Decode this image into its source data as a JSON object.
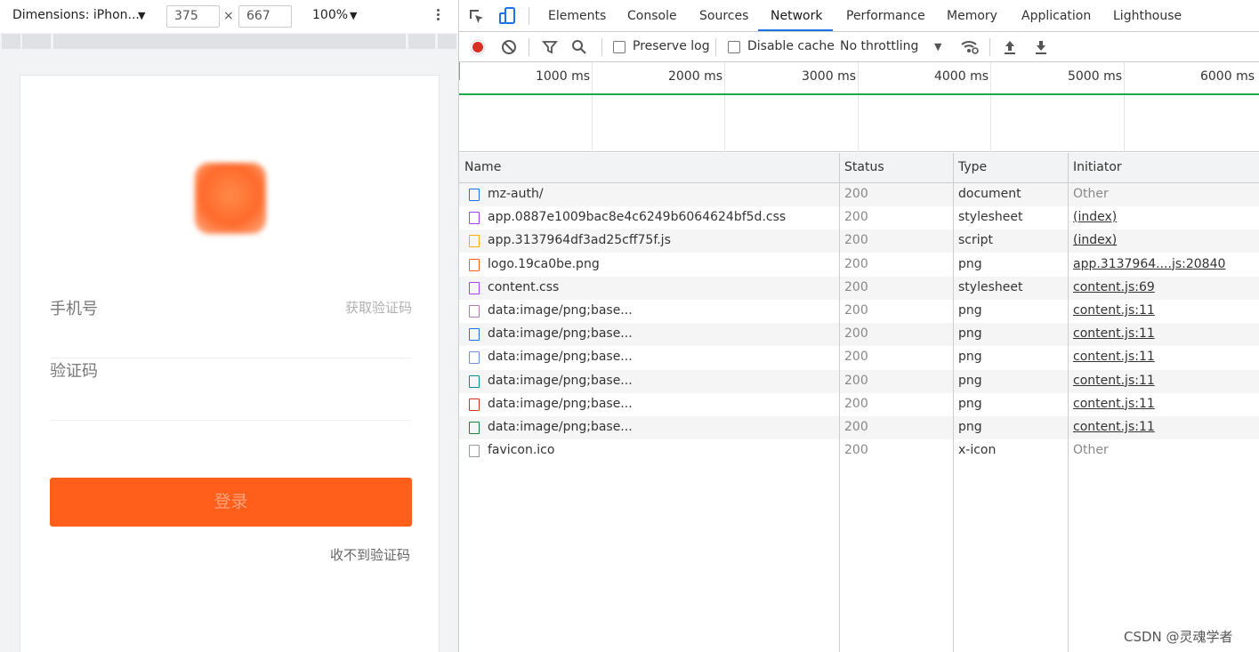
{
  "device_toolbar": {
    "dimensions_label": "Dimensions: iPhon...",
    "width": "375",
    "height": "667",
    "separator": "×",
    "zoom": "100%"
  },
  "phone_page": {
    "phone_label": "手机号",
    "get_code_label": "获取验证码",
    "code_label": "验证码",
    "login_button": "登录",
    "no_code_link": "收不到验证码",
    "accent_color": "#ff5f1a"
  },
  "devtools": {
    "tabs": [
      "Elements",
      "Console",
      "Sources",
      "Network",
      "Performance",
      "Memory",
      "Application",
      "Lighthouse"
    ],
    "active_tab": "Network",
    "toolbar": {
      "preserve_log": "Preserve log",
      "disable_cache": "Disable cache",
      "throttling": "No throttling"
    },
    "timeline_labels": [
      "1000 ms",
      "2000 ms",
      "3000 ms",
      "4000 ms",
      "5000 ms",
      "6000 ms"
    ],
    "columns": [
      "Name",
      "Status",
      "Type",
      "Initiator"
    ],
    "requests": [
      {
        "name": "mz-auth/",
        "status": "200",
        "type": "document",
        "initiator": "Other",
        "icon": "document-icon",
        "icon_color": "#1a73e8"
      },
      {
        "name": "app.0887e1009bac8e4c6249b6064624bf5d.css",
        "status": "200",
        "type": "stylesheet",
        "initiator": "(index)",
        "icon": "stylesheet-icon",
        "icon_color": "#a142f4"
      },
      {
        "name": "app.3137964df3ad25cff75f.js",
        "status": "200",
        "type": "script",
        "initiator": "(index)",
        "icon": "script-icon",
        "icon_color": "#f9ab00"
      },
      {
        "name": "logo.19ca0be.png",
        "status": "200",
        "type": "png",
        "initiator": "app.3137964....js:20840",
        "icon": "image-icon",
        "icon_color": "#ff5f1a"
      },
      {
        "name": "content.css",
        "status": "200",
        "type": "stylesheet",
        "initiator": "content.js:69",
        "icon": "stylesheet-icon",
        "icon_color": "#a142f4"
      },
      {
        "name": "data:image/png;base...",
        "status": "200",
        "type": "png",
        "initiator": "content.js:11",
        "icon": "image-icon",
        "icon_color": "#b07ab0"
      },
      {
        "name": "data:image/png;base...",
        "status": "200",
        "type": "png",
        "initiator": "content.js:11",
        "icon": "image-icon",
        "icon_color": "#1a73e8"
      },
      {
        "name": "data:image/png;base...",
        "status": "200",
        "type": "png",
        "initiator": "content.js:11",
        "icon": "image-icon",
        "icon_color": "#6f8fd8"
      },
      {
        "name": "data:image/png;base...",
        "status": "200",
        "type": "png",
        "initiator": "content.js:11",
        "icon": "image-icon",
        "icon_color": "#0b8a8a"
      },
      {
        "name": "data:image/png;base...",
        "status": "200",
        "type": "png",
        "initiator": "content.js:11",
        "icon": "image-icon",
        "icon_color": "#d93025"
      },
      {
        "name": "data:image/png;base...",
        "status": "200",
        "type": "png",
        "initiator": "content.js:11",
        "icon": "image-icon",
        "icon_color": "#188038"
      },
      {
        "name": "favicon.ico",
        "status": "200",
        "type": "x-icon",
        "initiator": "Other",
        "icon": "file-icon",
        "icon_color": "#999999"
      }
    ]
  },
  "watermark": "CSDN @灵魂学者"
}
